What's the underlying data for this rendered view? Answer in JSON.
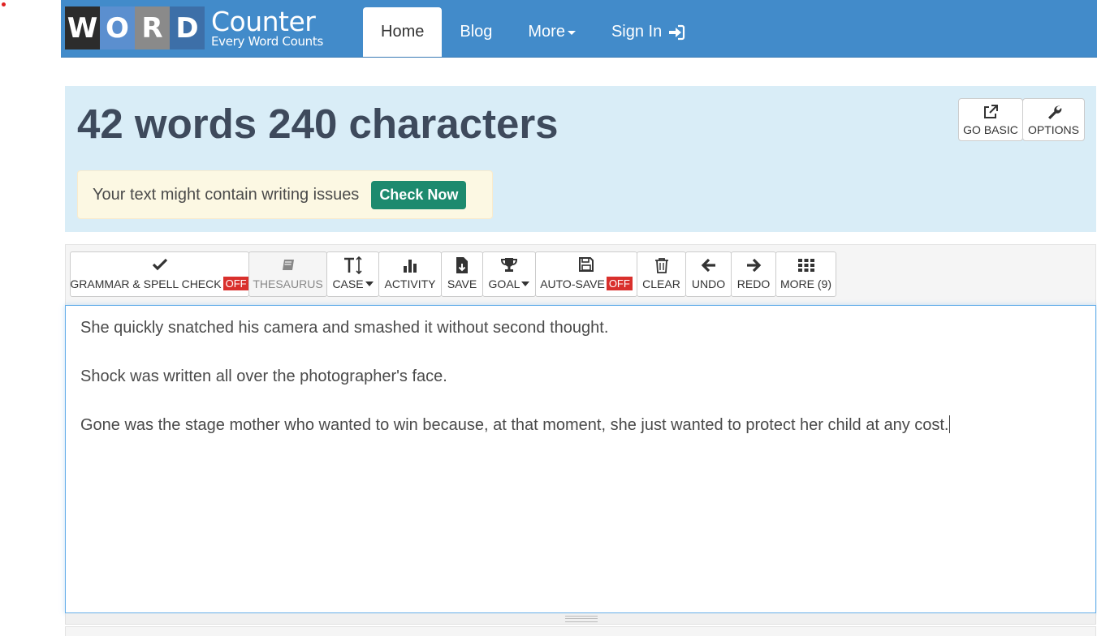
{
  "logo": {
    "letters": [
      "W",
      "O",
      "R",
      "D"
    ],
    "name": "Counter",
    "tagline": "Every Word Counts"
  },
  "nav": {
    "items": [
      {
        "label": "Home",
        "active": true
      },
      {
        "label": "Blog"
      },
      {
        "label": "More"
      },
      {
        "label": "Sign In"
      }
    ]
  },
  "header": {
    "headline": "42 words 240 characters",
    "go_basic": "GO BASIC",
    "options": "OPTIONS",
    "alert_text": "Your text might contain writing issues",
    "check_now": "Check Now"
  },
  "toolbar": {
    "grammar": "GRAMMAR & SPELL CHECK",
    "grammar_state": "OFF",
    "thesaurus": "THESAURUS",
    "case": "CASE",
    "activity": "ACTIVITY",
    "save": "SAVE",
    "goal": "GOAL",
    "autosave": "AUTO-SAVE",
    "autosave_state": "OFF",
    "clear": "CLEAR",
    "undo": "UNDO",
    "redo": "REDO",
    "more": "MORE (9)"
  },
  "editor": {
    "lines": [
      "She quickly snatched his camera and smashed it without second thought.",
      "Shock was written all over the photographer's face.",
      "Gone was the stage mother who wanted to win because, at that moment, she just wanted to protect her child at any cost."
    ]
  },
  "colors": {
    "navbar": "#428bca",
    "panel": "#d9edf7",
    "check_button": "#1d8a6e",
    "off_badge": "#d9302c"
  }
}
